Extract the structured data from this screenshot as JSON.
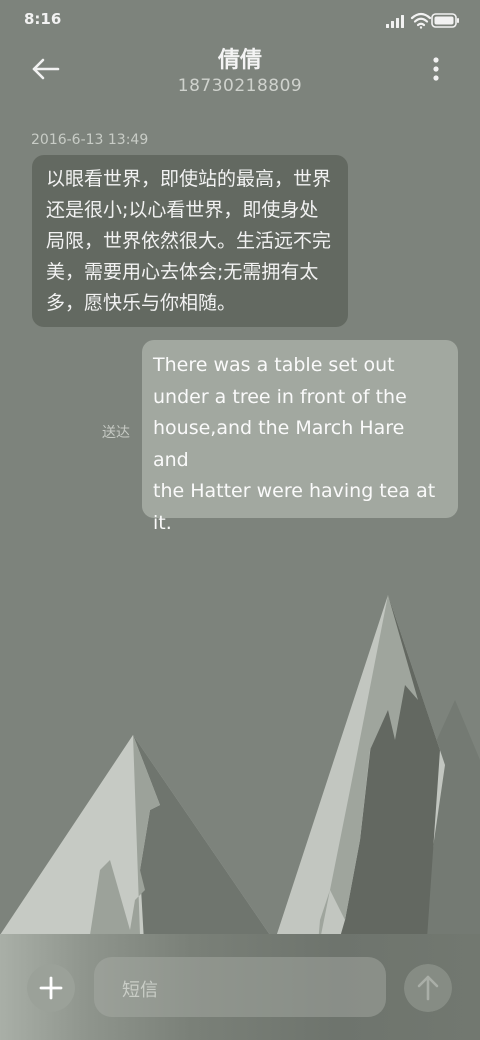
{
  "status_bar": {
    "time": "8:16"
  },
  "header": {
    "title": "倩倩",
    "phone": "18730218809"
  },
  "conversation": {
    "timestamp": "2016-6-13 13:49",
    "messages": [
      {
        "direction": "incoming",
        "text": "以眼看世界，即使站的最高，世界\n还是很小;以心看世界，即使身处\n局限，世界依然很大。生活远不完\n美，需要用心去体会;无需拥有太\n多，愿快乐与你相随。"
      },
      {
        "direction": "outgoing",
        "text": "There was a table set out\nunder a tree in front of the\nhouse,and the March Hare and\nthe Hatter were having tea at\nit.",
        "status": "送达"
      }
    ]
  },
  "composer": {
    "placeholder": "短信"
  },
  "icons": {
    "back": "arrow-left-icon",
    "more": "more-vertical-icon",
    "add": "plus-icon",
    "send": "arrow-up-icon",
    "signal": "signal-icon",
    "wifi": "wifi-icon",
    "battery": "battery-icon"
  },
  "colors": {
    "background": "#7d837c",
    "incoming_bubble": "#636961",
    "outgoing_bubble": "#a2a8a0"
  }
}
